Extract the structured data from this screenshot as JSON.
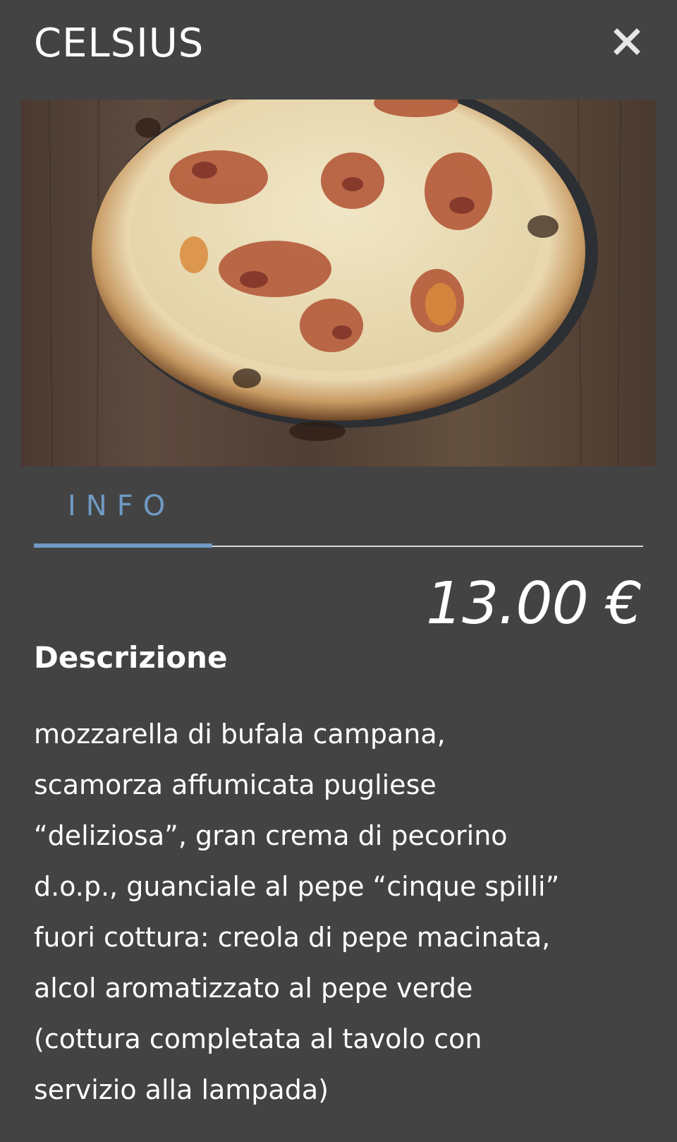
{
  "header": {
    "title": "CELSIUS",
    "close_icon": "close-icon"
  },
  "photo": {
    "subject": "pizza-image"
  },
  "tabs": [
    {
      "label": "INFO",
      "active": true
    }
  ],
  "product": {
    "price": "13.00 €",
    "description_heading": "Descrizione",
    "description_lines": [
      "mozzarella di bufala campana,",
      "scamorza affumicata pugliese",
      "“deliziosa”, gran crema di pecorino",
      "d.o.p., guanciale al pepe “cinque spilli”",
      "fuori cottura: creola di pepe macinata,",
      "alcol aromatizzato al pepe verde",
      "(cottura completata al tavolo con",
      "servizio alla lampada)"
    ]
  },
  "colors": {
    "background": "#434343",
    "accent": "#6f9ac4",
    "text": "#ffffff",
    "divider": "#d8d8d8"
  }
}
